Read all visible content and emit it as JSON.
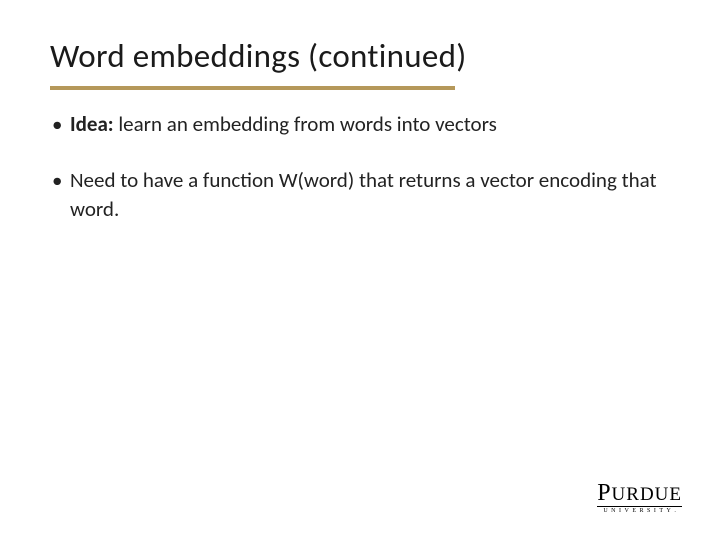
{
  "title": "Word embeddings (continued)",
  "bullets": [
    {
      "lead": "Idea:",
      "rest": "  learn an embedding from words into vectors"
    },
    {
      "lead": "",
      "rest": "Need to have a function W(word) that returns a vector encoding that word."
    }
  ],
  "logo": {
    "name": "PURDUE",
    "sub": "UNIVERSITY",
    "dot": "."
  },
  "colors": {
    "accent": "#b5985a"
  }
}
